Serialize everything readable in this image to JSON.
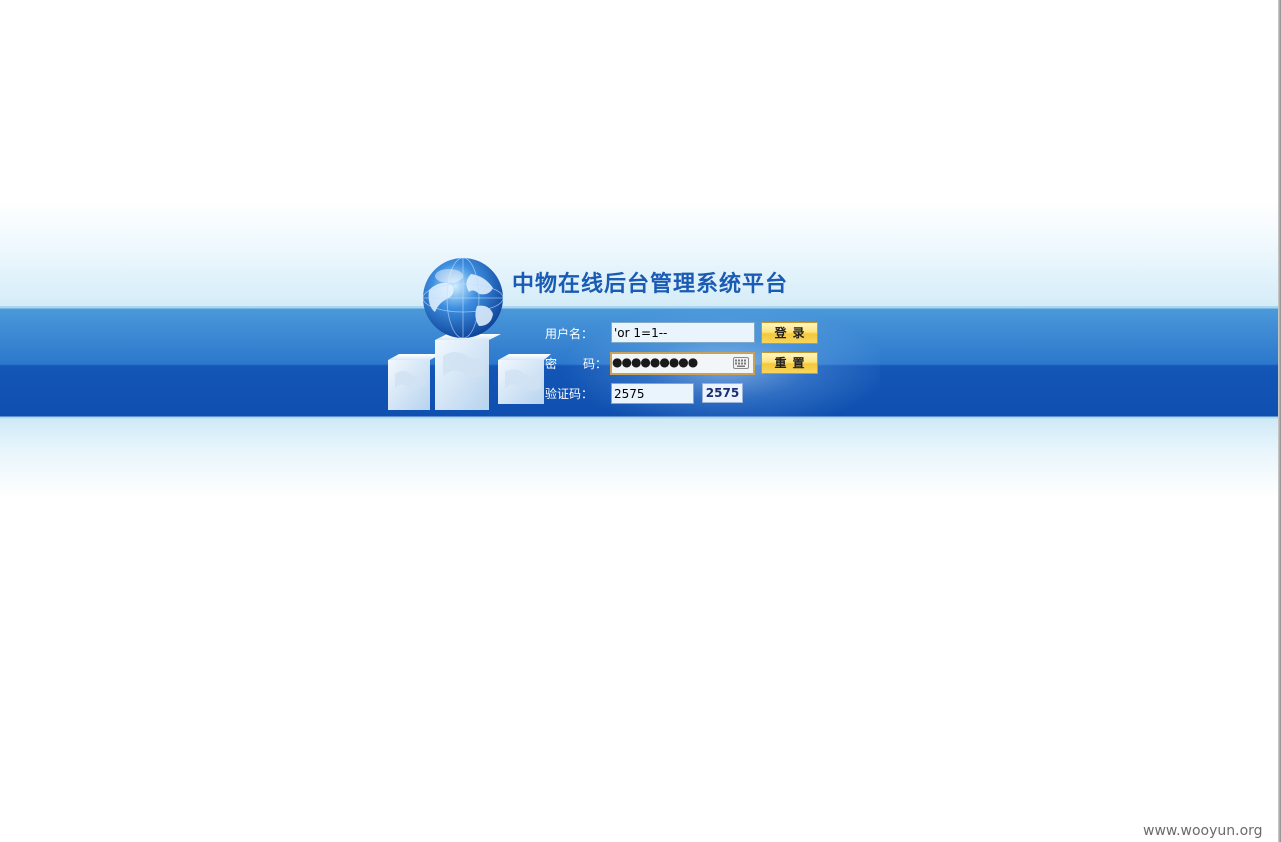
{
  "title": "中物在线后台管理系统平台",
  "form": {
    "username_label": "用户名：",
    "username_value": "'or 1=1--",
    "password_label_left": "密",
    "password_label_right": "码：",
    "password_mask": "●●●●●●●●●",
    "captcha_label": "验证码：",
    "captcha_value": "2575",
    "captcha_image_text": "2575",
    "login_button": "登录",
    "reset_button": "重置"
  },
  "watermark": "www.wooyun.org",
  "icons": {
    "logo": "globe-on-cubes-logo-icon",
    "keyboard": "virtual-keyboard-icon"
  },
  "colors": {
    "band_top": "#4b98da",
    "band_bottom": "#0f4faf",
    "title": "#1a5bb4",
    "button": "#ffe37a",
    "input_bg": "#e9f4fd"
  }
}
